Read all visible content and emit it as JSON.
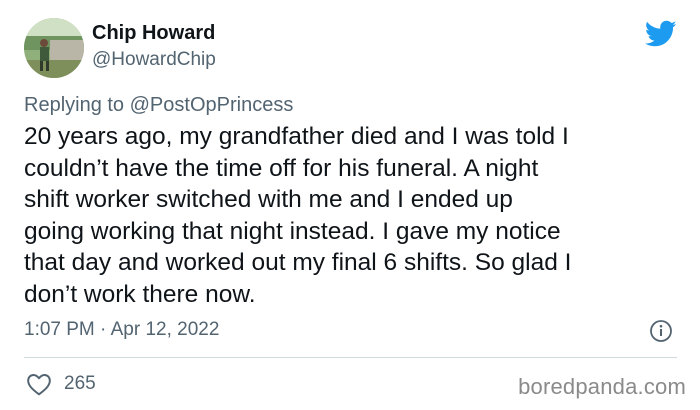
{
  "tweet": {
    "author_name": "Chip Howard",
    "author_handle": "@HowardChip",
    "reply_prefix": "Replying to",
    "reply_to": "@PostOpPrincess",
    "text": "20 years ago, my grandfather died and I was told I\ncouldn’t have the time off for his funeral.  A night\nshift worker switched with me and I ended up\ngoing working that night instead.  I gave my notice\nthat day and worked out my final 6 shifts. So glad I\ndon’t work there now.",
    "timestamp": "1:07 PM · Apr 12, 2022",
    "like_count": "265"
  },
  "icons": {
    "brand": "twitter-bird-icon",
    "info": "info-icon",
    "like": "heart-icon"
  },
  "watermark": "boredpanda.com",
  "colors": {
    "twitter_blue": "#1d9bf0",
    "secondary_text": "#536471",
    "primary_text": "#0f1419",
    "divider": "#cfd9de"
  }
}
